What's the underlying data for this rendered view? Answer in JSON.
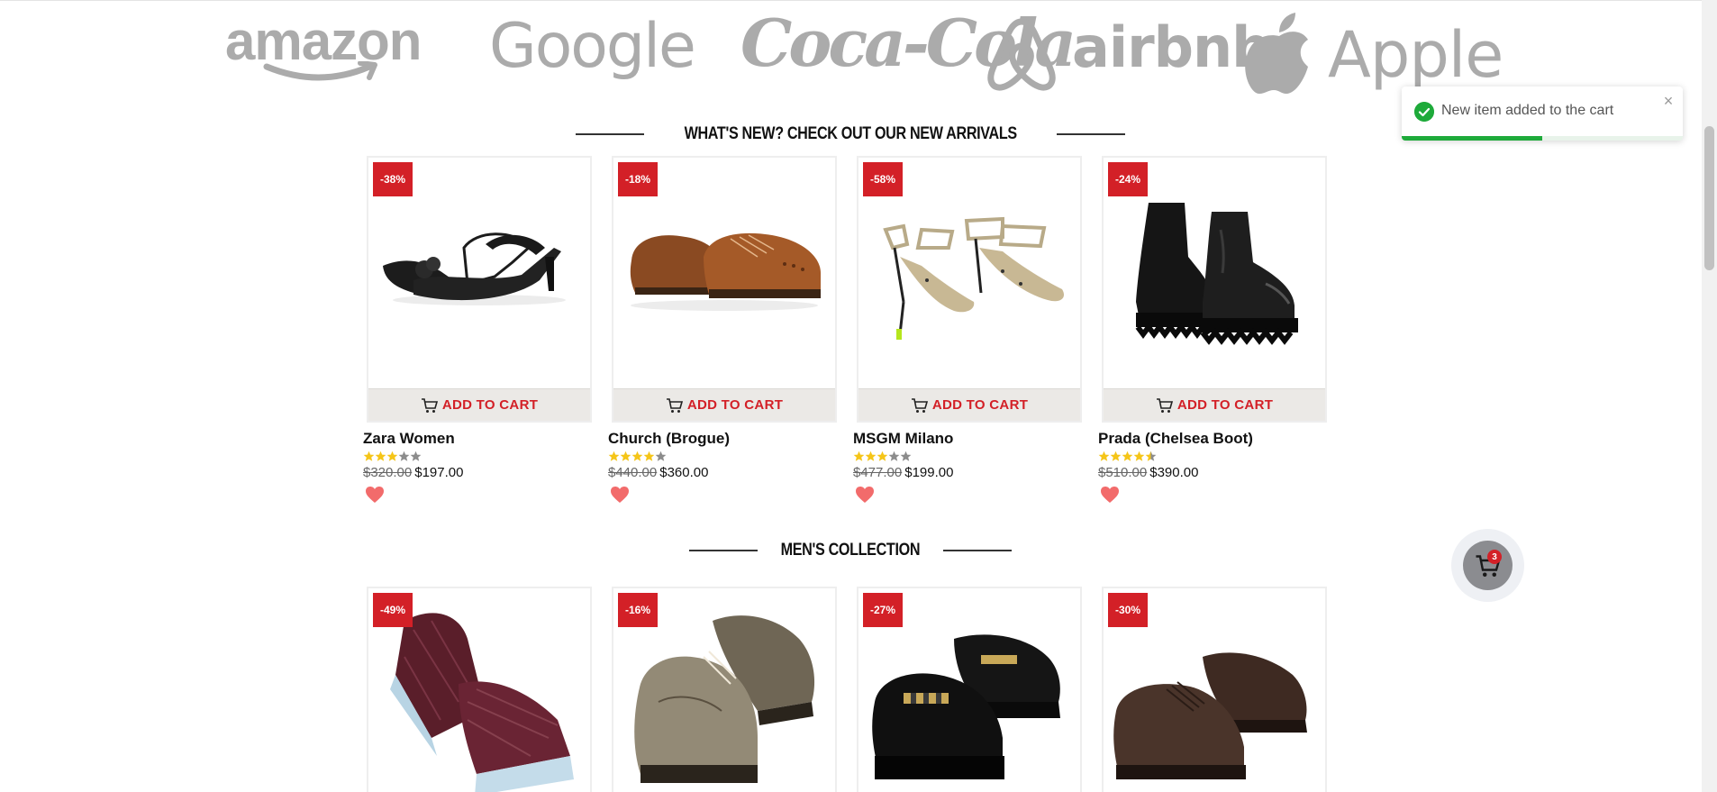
{
  "brands": [
    {
      "name": "amazon",
      "icon": "amazon-logo"
    },
    {
      "name": "Google",
      "icon": "google-logo"
    },
    {
      "name": "Coca-Cola",
      "icon": "coca-cola-logo"
    },
    {
      "name": "airbnb",
      "icon": "airbnb-logo"
    },
    {
      "name": "Apple",
      "icon": "apple-logo"
    }
  ],
  "sections": {
    "new_arrivals": {
      "title": "What's new? Check out our new arrivals",
      "products": [
        {
          "badge": "-38%",
          "name": "Zara Women",
          "rating": 3,
          "old_price": "$320.00",
          "price": "$197.00",
          "image": "black-slingback-heel",
          "button": "ADD TO CART"
        },
        {
          "badge": "-18%",
          "name": "Church (Brogue)",
          "rating": 4,
          "old_price": "$440.00",
          "price": "$360.00",
          "image": "brown-brogue-oxford",
          "button": "ADD TO CART"
        },
        {
          "badge": "-58%",
          "name": "MSGM Milano",
          "rating": 3,
          "old_price": "$477.00",
          "price": "$199.00",
          "image": "beige-strappy-sandal",
          "button": "ADD TO CART"
        },
        {
          "badge": "-24%",
          "name": "Prada (Chelsea Boot)",
          "rating": 4.5,
          "old_price": "$510.00",
          "price": "$390.00",
          "image": "black-chelsea-boot",
          "button": "ADD TO CART"
        }
      ]
    },
    "mens": {
      "title": "Men's Collection",
      "products": [
        {
          "badge": "-49%",
          "image": "burgundy-woven-slip-on"
        },
        {
          "badge": "-16%",
          "image": "taupe-wingtip-derby"
        },
        {
          "badge": "-27%",
          "image": "black-chain-loafer"
        },
        {
          "badge": "-30%",
          "image": "brown-suede-derby"
        }
      ]
    }
  },
  "toast": {
    "message": "New item added to the cart",
    "close_label": "×",
    "progress": 0.5,
    "icon": "check-circle-icon"
  },
  "floating_cart": {
    "count": "3",
    "icon": "cart-icon"
  },
  "colors": {
    "accent": "#d32027",
    "logo_grey": "#ababab",
    "success": "#1eaa3a",
    "star": "#f5c518"
  }
}
